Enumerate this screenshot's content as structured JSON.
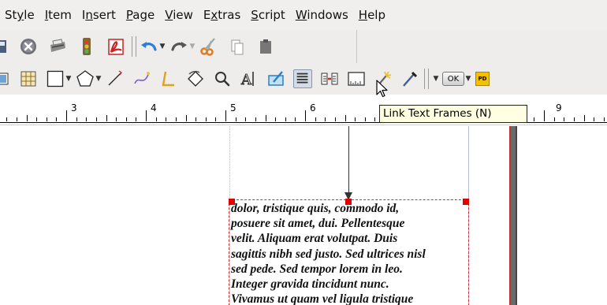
{
  "menu": [
    {
      "pre": "St",
      "u": "y",
      "post": "le"
    },
    {
      "pre": "",
      "u": "I",
      "post": "tem"
    },
    {
      "pre": "I",
      "u": "n",
      "post": "sert"
    },
    {
      "pre": "",
      "u": "P",
      "post": "age"
    },
    {
      "pre": "",
      "u": "V",
      "post": "iew"
    },
    {
      "pre": "E",
      "u": "x",
      "post": "tras"
    },
    {
      "pre": "",
      "u": "S",
      "post": "cript"
    },
    {
      "pre": "",
      "u": "W",
      "post": "indows"
    },
    {
      "pre": "",
      "u": "H",
      "post": "elp"
    }
  ],
  "toolbar": {
    "ok_label": "OK",
    "pdf_label": "PD"
  },
  "ruler": {
    "labels": [
      "3",
      "4",
      "5",
      "6",
      "9"
    ]
  },
  "tooltip": "Link Text Frames (N)",
  "frame_text": [
    "dolor, tristique quis, commodo id,",
    "posuere sit amet, dui. Pellentesque",
    "velit. Aliquam erat volutpat. Duis",
    "sagittis nibh sed justo. Sed ultrices nisl",
    "sed pede. Sed tempor lorem in leo.",
    "Integer gravida tincidunt nunc.",
    "Vivamus ut quam vel ligula tristique"
  ],
  "colors": {
    "frame_border": "#d23030",
    "handle": "#e00000",
    "tooltip_bg": "#ffffe1"
  }
}
